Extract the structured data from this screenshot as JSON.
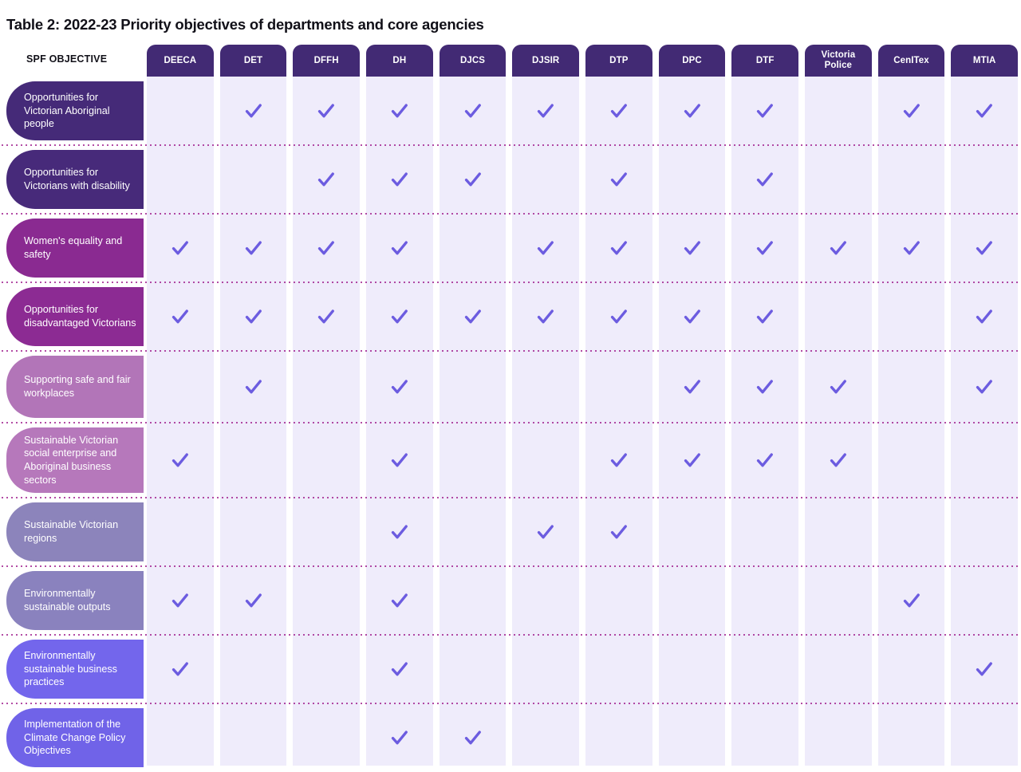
{
  "title": "Table 2: 2022-23 Priority objectives of departments and core agencies",
  "row_header_label": "SPF OBJECTIVE",
  "colors": {
    "header_tab": "#422a74",
    "cell_background": "#efecfb",
    "check": "#6c5ce0",
    "separator_dot": "#a01f8e",
    "page_background": "#ffffff",
    "title_text": "#111018"
  },
  "columns": [
    {
      "id": "deeca",
      "label": "DEECA"
    },
    {
      "id": "det",
      "label": "DET"
    },
    {
      "id": "dffh",
      "label": "DFFH"
    },
    {
      "id": "dh",
      "label": "DH"
    },
    {
      "id": "djcs",
      "label": "DJCS"
    },
    {
      "id": "djsir",
      "label": "DJSIR"
    },
    {
      "id": "dtp",
      "label": "DTP"
    },
    {
      "id": "dpc",
      "label": "DPC"
    },
    {
      "id": "dtf",
      "label": "DTF"
    },
    {
      "id": "victoria_police",
      "label": "Victoria Police"
    },
    {
      "id": "cenitex",
      "label": "CenITex"
    },
    {
      "id": "mtia",
      "label": "MTIA"
    }
  ],
  "rows": [
    {
      "label": "Opportunities for Victorian Aboriginal people",
      "pill_color": "#452a78",
      "checks": [
        false,
        true,
        true,
        true,
        true,
        true,
        true,
        true,
        true,
        false,
        true,
        true
      ]
    },
    {
      "label": "Opportunities for Victorians with disability",
      "pill_color": "#472a7a",
      "checks": [
        false,
        false,
        true,
        true,
        true,
        false,
        true,
        false,
        true,
        false,
        false,
        false
      ]
    },
    {
      "label": "Women's equality and safety",
      "pill_color": "#8a2a91",
      "checks": [
        true,
        true,
        true,
        true,
        false,
        true,
        true,
        true,
        true,
        true,
        true,
        true
      ]
    },
    {
      "label": "Opportunities for disadvantaged Victorians",
      "pill_color": "#8c2b93",
      "checks": [
        true,
        true,
        true,
        true,
        true,
        true,
        true,
        true,
        true,
        false,
        false,
        true
      ]
    },
    {
      "label": "Supporting safe and fair workplaces",
      "pill_color": "#b275b8",
      "checks": [
        false,
        true,
        false,
        true,
        false,
        false,
        false,
        true,
        true,
        true,
        false,
        true
      ]
    },
    {
      "label": "Sustainable Victorian social enterprise and Aboriginal business sectors",
      "pill_color": "#b678bb",
      "checks": [
        true,
        false,
        false,
        true,
        false,
        false,
        true,
        true,
        true,
        true,
        false,
        false
      ]
    },
    {
      "label": "Sustainable Victorian regions",
      "pill_color": "#8c84bb",
      "checks": [
        false,
        false,
        false,
        true,
        false,
        true,
        true,
        false,
        false,
        false,
        false,
        false
      ]
    },
    {
      "label": "Environmentally sustainable outputs",
      "pill_color": "#8a82be",
      "checks": [
        true,
        true,
        false,
        true,
        false,
        false,
        false,
        false,
        false,
        false,
        true,
        false
      ]
    },
    {
      "label": "Environmentally sustainable business practices",
      "pill_color": "#7366ec",
      "checks": [
        true,
        false,
        false,
        true,
        false,
        false,
        false,
        false,
        false,
        false,
        false,
        true
      ]
    },
    {
      "label": "Implementation of the Climate Change Policy Objectives",
      "pill_color": "#7063e8",
      "checks": [
        false,
        false,
        false,
        true,
        true,
        false,
        false,
        false,
        false,
        false,
        false,
        false
      ]
    }
  ]
}
